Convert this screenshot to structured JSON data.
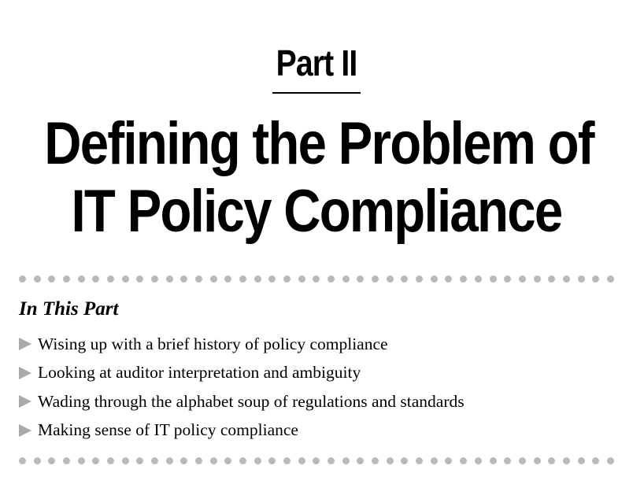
{
  "part": {
    "label": "Part II"
  },
  "title": {
    "line1": "Defining the Problem of",
    "line2": "IT Policy Compliance"
  },
  "in_this_part": {
    "heading": "In This Part",
    "items": [
      "Wising up with a brief history of policy compliance",
      "Looking at auditor interpretation and ambiguity",
      "Wading through the alphabet soup of regulations and standards",
      "Making sense of IT policy compliance"
    ]
  },
  "colors": {
    "text": "#000000",
    "dot": "#b9b9b9",
    "arrow": "#a9a9a9"
  },
  "icons": {
    "bullet": "triangle-right-icon",
    "divider": "dotted-divider"
  }
}
